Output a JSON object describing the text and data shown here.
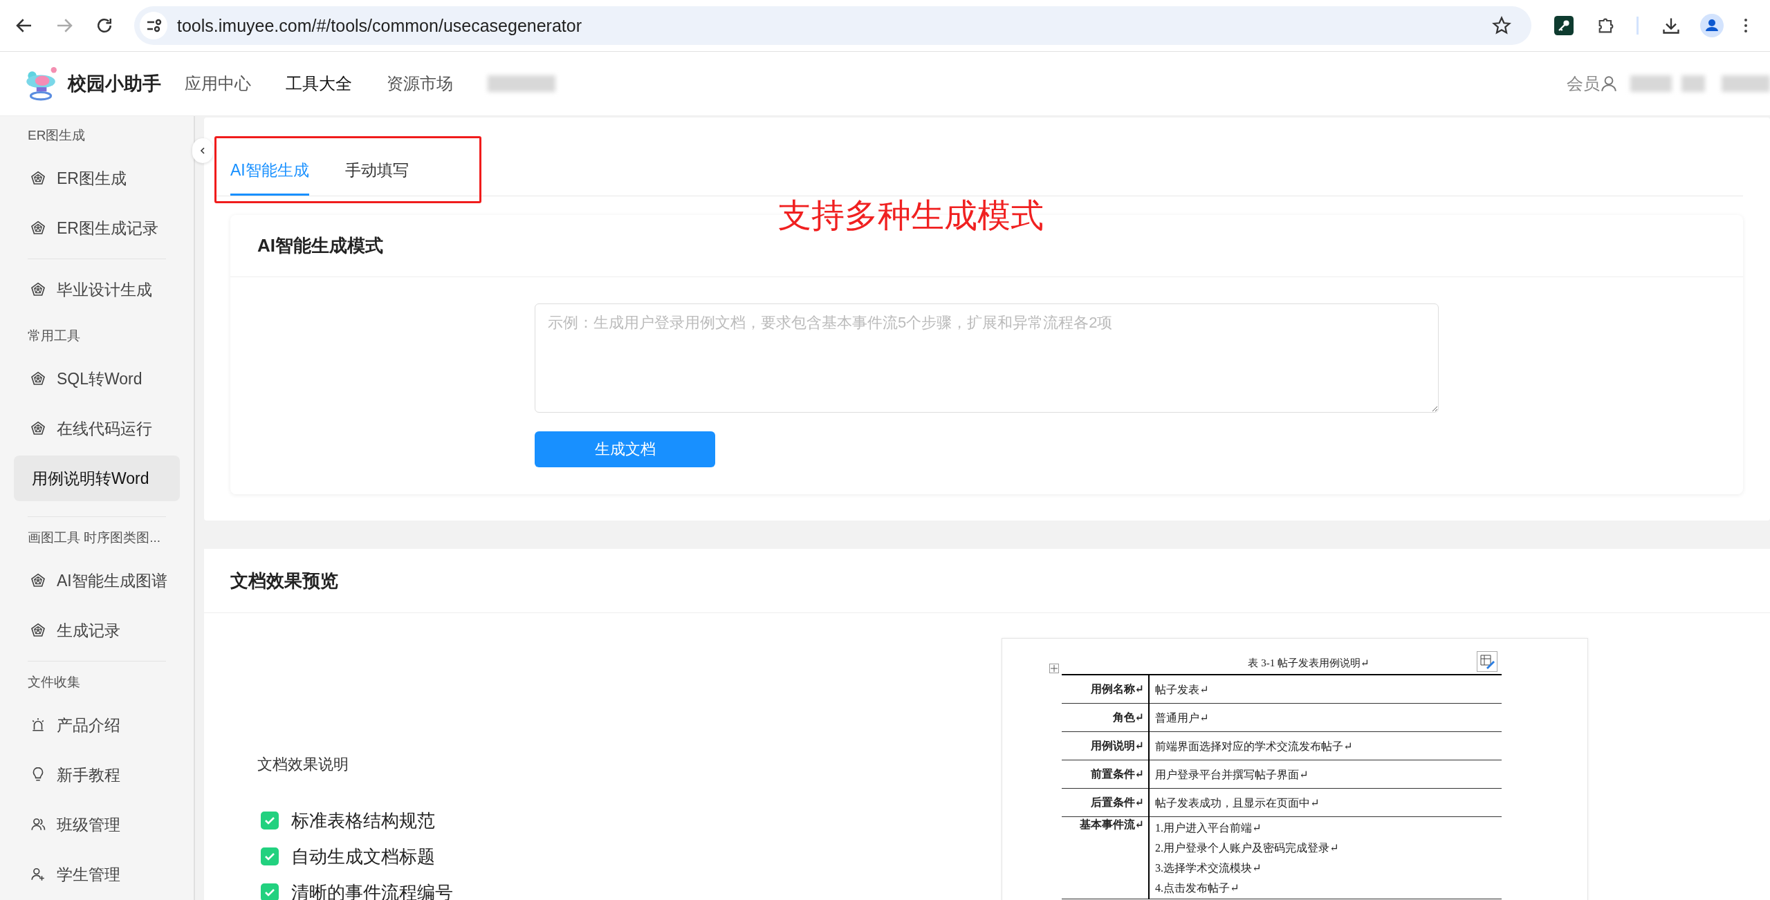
{
  "browser": {
    "url": "tools.imuyee.com/#/tools/common/usecasegenerator"
  },
  "header": {
    "app_name": "校园小助手",
    "nav": [
      {
        "label": "应用中心",
        "selected": false
      },
      {
        "label": "工具大全",
        "selected": true
      },
      {
        "label": "资源市场",
        "selected": false
      }
    ],
    "member": "会员"
  },
  "sidebar": {
    "entries": [
      {
        "kind": "section",
        "label": "ER图生成"
      },
      {
        "kind": "pentagon",
        "label": "ER图生成",
        "selected": false
      },
      {
        "kind": "pentagon",
        "label": "ER图生成记录",
        "selected": false
      },
      {
        "kind": "divider"
      },
      {
        "kind": "pentagon",
        "label": "毕业设计生成",
        "selected": false
      },
      {
        "kind": "section",
        "label": "常用工具"
      },
      {
        "kind": "pentagon",
        "label": "SQL转Word",
        "selected": false
      },
      {
        "kind": "pentagon",
        "label": "在线代码运行",
        "selected": false
      },
      {
        "kind": "plain",
        "label": "用例说明转Word",
        "selected": true
      },
      {
        "kind": "divider"
      },
      {
        "kind": "section",
        "label": "画图工具 时序图类图..."
      },
      {
        "kind": "pentagon",
        "label": "AI智能生成图谱",
        "selected": false
      },
      {
        "kind": "pentagon",
        "label": "生成记录",
        "selected": false
      },
      {
        "kind": "divider"
      },
      {
        "kind": "section",
        "label": "文件收集"
      },
      {
        "kind": "alarm",
        "label": "产品介绍",
        "selected": false
      },
      {
        "kind": "bulb",
        "label": "新手教程",
        "selected": false
      },
      {
        "kind": "group",
        "label": "班级管理",
        "selected": false
      },
      {
        "kind": "adduser",
        "label": "学生管理",
        "selected": false
      }
    ]
  },
  "tabs": [
    {
      "label": "AI智能生成",
      "selected": true
    },
    {
      "label": "手动填写",
      "selected": false
    }
  ],
  "annotation": {
    "text": "支持多种生成模式"
  },
  "mode_card": {
    "title": "AI智能生成模式",
    "placeholder": "示例：生成用户登录用例文档，要求包含基本事件流5个步骤，扩展和异常流程各2项",
    "button": "生成文档"
  },
  "preview": {
    "title": "文档效果预览",
    "description": "文档效果说明",
    "features": [
      {
        "label": "标准表格结构规范",
        "checked": true
      },
      {
        "label": "自动生成文档标题",
        "checked": true
      },
      {
        "label": "清晰的事件流程编号",
        "checked": true
      }
    ],
    "document": {
      "caption": "表 3-1  帖子发表用例说明↵",
      "rows": [
        {
          "label": "用例名称↵",
          "lines": [
            "帖子发表↵"
          ]
        },
        {
          "label": "角色↵",
          "lines": [
            "普通用户↵"
          ]
        },
        {
          "label": "用例说明↵",
          "lines": [
            "前端界面选择对应的学术交流发布帖子↵"
          ]
        },
        {
          "label": "前置条件↵",
          "lines": [
            "用户登录平台并撰写帖子界面↵"
          ]
        },
        {
          "label": "后置条件↵",
          "lines": [
            "帖子发表成功，且显示在页面中↵"
          ]
        },
        {
          "label": "基本事件流↵",
          "lines": [
            "1.用户进入平台前端↵",
            "2.用户登录个人账户及密码完成登录↵",
            "3.选择学术交流模块↵",
            "4.点击发布帖子↵"
          ]
        }
      ]
    }
  }
}
